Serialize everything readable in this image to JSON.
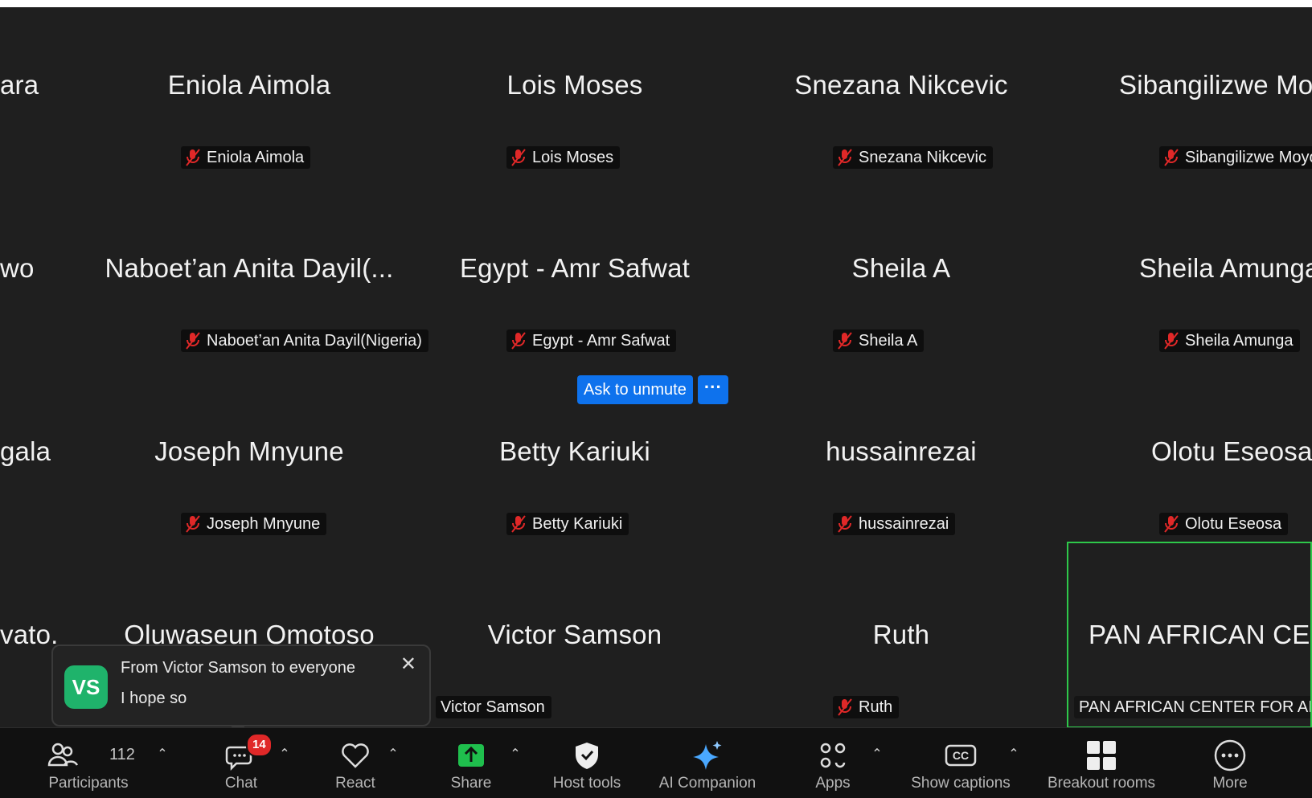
{
  "tiles": [
    {
      "big": "ara",
      "tag": ""
    },
    {
      "big": "Eniola Aimola",
      "tag": "Eniola Aimola"
    },
    {
      "big": "Lois Moses",
      "tag": "Lois Moses"
    },
    {
      "big": "Snezana Nikcevic",
      "tag": "Snezana Nikcevic"
    },
    {
      "big": "Sibangilizwe Mo",
      "tag": "Sibangilizwe Moyo"
    },
    {
      "big": "wo",
      "tag": ""
    },
    {
      "big": "Naboet’an Anita Dayil(...",
      "tag": "Naboet’an Anita Dayil(Nigeria)"
    },
    {
      "big": "Egypt - Amr Safwat",
      "tag": "Egypt - Amr Safwat"
    },
    {
      "big": "Sheila A",
      "tag": "Sheila A"
    },
    {
      "big": "Sheila Amunga",
      "tag": "Sheila Amunga"
    },
    {
      "big": "gala",
      "tag": ""
    },
    {
      "big": "Joseph Mnyune",
      "tag": "Joseph Mnyune"
    },
    {
      "big": "Betty Kariuki",
      "tag": "Betty Kariuki"
    },
    {
      "big": "hussainrezai",
      "tag": "hussainrezai"
    },
    {
      "big": "Olotu Eseosa",
      "tag": "Olotu Eseosa"
    },
    {
      "big": "vato.",
      "tag": ""
    },
    {
      "big": "Oluwaseun Omotoso",
      "tag": ""
    },
    {
      "big": "Victor Samson",
      "tag": "Victor Samson"
    },
    {
      "big": "Ruth",
      "tag": "Ruth"
    },
    {
      "big": "PAN AFRICAN CEN",
      "tag": "PAN AFRICAN CENTER FOR AI"
    }
  ],
  "ask_unmute": {
    "label": "Ask to unmute",
    "more": "···"
  },
  "chat_popup": {
    "avatar": "VS",
    "from": "From Victor Samson to everyone",
    "message": "I hope so",
    "close": "✕"
  },
  "toolbar": {
    "participants": {
      "label": "Participants",
      "count": "112",
      "icon": "participants-icon"
    },
    "chat": {
      "label": "Chat",
      "badge": "14",
      "icon": "chat-icon"
    },
    "react": {
      "label": "React",
      "icon": "heart-icon"
    },
    "share": {
      "label": "Share",
      "icon": "share-arrow-icon"
    },
    "host_tools": {
      "label": "Host tools",
      "icon": "shield-icon"
    },
    "ai_companion": {
      "label": "AI Companion",
      "icon": "sparkle-icon"
    },
    "apps": {
      "label": "Apps",
      "icon": "apps-icon"
    },
    "captions": {
      "label": "Show captions",
      "icon": "cc-icon"
    },
    "breakout": {
      "label": "Breakout rooms",
      "icon": "grid-icon"
    },
    "more": {
      "label": "More",
      "icon": "ellipsis-icon"
    }
  },
  "colors": {
    "background": "#1f1f1f",
    "toolbar": "#111111",
    "accent_blue": "#0e72ed",
    "active_speaker": "#2ec84a",
    "muted_red": "#e02828",
    "avatar_green": "#1fb36b"
  }
}
